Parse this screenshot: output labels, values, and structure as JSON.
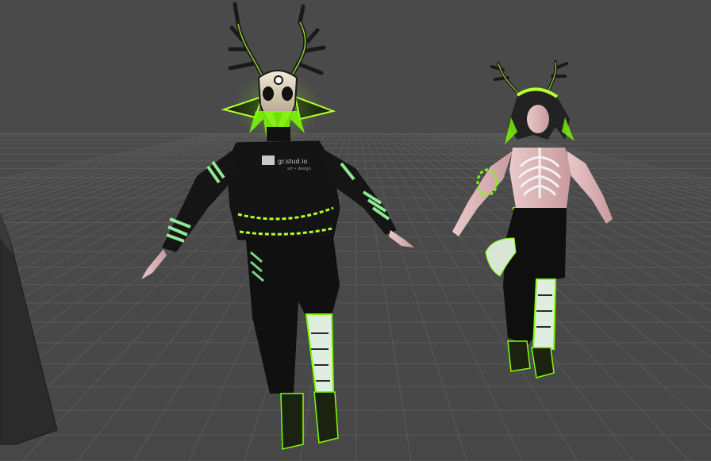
{
  "scene": {
    "view": "scene-viewport",
    "grid": true,
    "background_color": "#484848",
    "grid_color": "#5a5a5a",
    "accent_color": "#b6ff2a",
    "objects": [
      {
        "name": "deer-skull-avatar",
        "selected": false
      },
      {
        "name": "skeleton-avatar",
        "selected": false
      },
      {
        "name": "panel-block",
        "selected": false
      }
    ]
  },
  "avatar_left": {
    "sweater_logo_text": "gr.stud.io",
    "sweater_logo_subtext": "art • design"
  }
}
